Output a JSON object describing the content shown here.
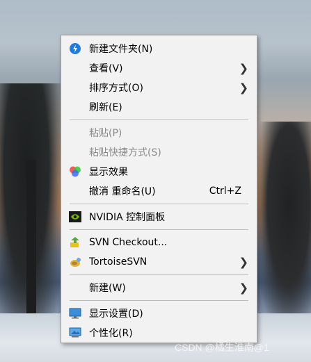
{
  "menu": {
    "items": [
      {
        "label": "新建文件夹(N)",
        "icon": "new-folder-icon"
      },
      {
        "label": "查看(V)",
        "submenu": true
      },
      {
        "label": "排序方式(O)",
        "submenu": true
      },
      {
        "label": "刷新(E)"
      },
      {
        "label": "粘贴(P)",
        "disabled": true
      },
      {
        "label": "粘贴快捷方式(S)",
        "disabled": true
      },
      {
        "label": "显示效果",
        "icon": "display-effects-icon"
      },
      {
        "label": "撤消 重命名(U)",
        "shortcut": "Ctrl+Z"
      },
      {
        "label": "NVIDIA 控制面板",
        "icon": "nvidia-icon"
      },
      {
        "label": "SVN Checkout...",
        "icon": "svn-checkout-icon"
      },
      {
        "label": "TortoiseSVN",
        "icon": "tortoisesvn-icon",
        "submenu": true
      },
      {
        "label": "新建(W)",
        "submenu": true
      },
      {
        "label": "显示设置(D)",
        "icon": "display-settings-icon"
      },
      {
        "label": "个性化(R)",
        "icon": "personalize-icon"
      }
    ]
  },
  "watermark": "CSDN @橘生淮南@1"
}
